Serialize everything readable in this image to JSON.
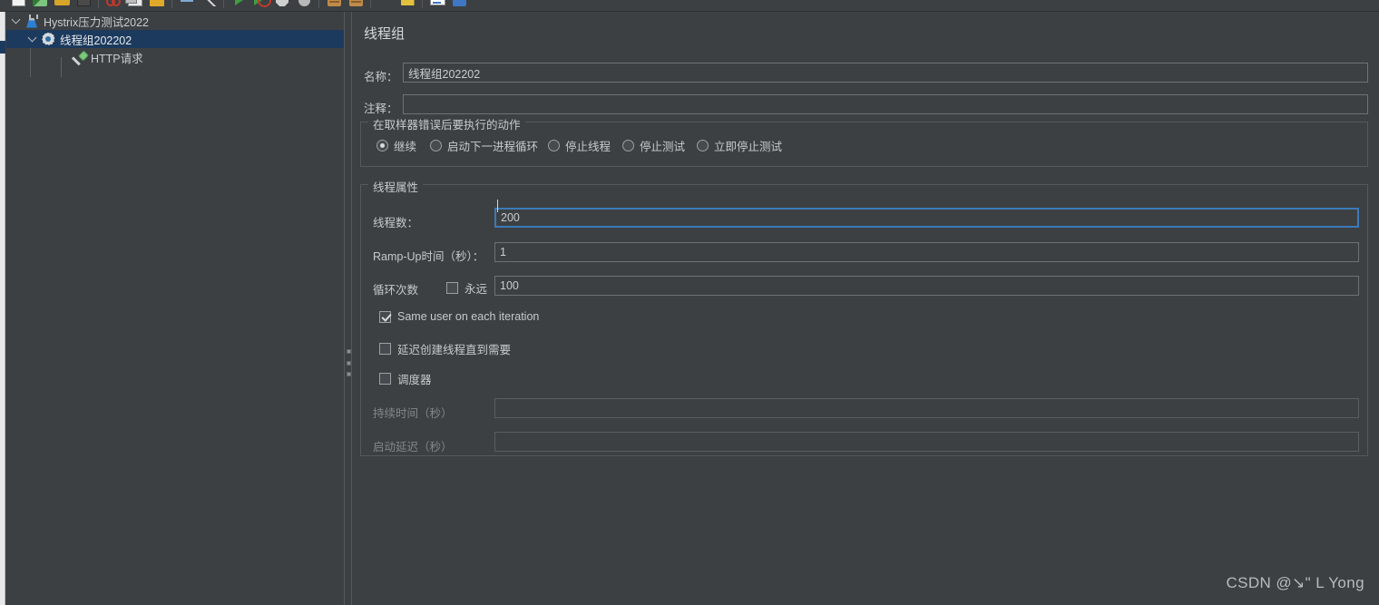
{
  "toolbar": {
    "icons": [
      "new-file-icon",
      "template-icon",
      "open-icon",
      "save-icon",
      "separator",
      "cut-icon",
      "copy-icon",
      "paste-icon",
      "separator",
      "expand-collapse-icon",
      "toggle-icon",
      "separator",
      "start-icon",
      "start-no-pauses-icon",
      "stop-icon",
      "shutdown-icon",
      "separator",
      "clear-icon",
      "clear-all-icon",
      "separator",
      "search-dots-icon",
      "function-helper-icon",
      "separator",
      "log-viewer-icon",
      "add-icon"
    ]
  },
  "tree": {
    "nodes": [
      {
        "label": "Hystrix压力测试2022",
        "icon": "flask-icon",
        "expanded": true,
        "selected": false,
        "depth": 0
      },
      {
        "label": "线程组202202",
        "icon": "gear-icon",
        "expanded": true,
        "selected": true,
        "depth": 1
      },
      {
        "label": "HTTP请求",
        "icon": "pipette-icon",
        "expanded": false,
        "selected": false,
        "depth": 2
      }
    ]
  },
  "panel": {
    "title": "线程组",
    "name_label": "名称：",
    "name_value": "线程组202202",
    "comment_label": "注释：",
    "comment_value": "",
    "comment_placeholder": ""
  },
  "error_action": {
    "group_title": "在取样器错误后要执行的动作",
    "options": [
      {
        "label": "继续",
        "selected": true
      },
      {
        "label": "启动下一进程循环",
        "selected": false
      },
      {
        "label": "停止线程",
        "selected": false
      },
      {
        "label": "停止测试",
        "selected": false
      },
      {
        "label": "立即停止测试",
        "selected": false
      }
    ]
  },
  "thread_properties": {
    "group_title": "线程属性",
    "num_threads_label": "线程数：",
    "num_threads_value": "200",
    "ramp_up_label": "Ramp-Up时间（秒）：",
    "ramp_up_value": "1",
    "loop_count_label": "循环次数",
    "forever_label": "永远",
    "forever_checked": false,
    "loop_count_value": "100",
    "same_user_label": "Same user on each iteration",
    "same_user_checked": true,
    "delayed_start_label": "延迟创建线程直到需要",
    "delayed_start_checked": false,
    "scheduler_label": "调度器",
    "scheduler_checked": false,
    "duration_label": "持续时间（秒）",
    "duration_value": "",
    "duration_enabled": false,
    "startup_delay_label": "启动延迟（秒）",
    "startup_delay_value": "",
    "startup_delay_enabled": false
  },
  "watermark": {
    "text": "CSDN @↘\" L Yong"
  },
  "colors": {
    "background": "#3c4043",
    "selection": "#1c3a5e",
    "focus_border": "#3d7ab8",
    "text": "#c7cacd",
    "text_disabled": "#82878b",
    "border": "#6d7276"
  }
}
